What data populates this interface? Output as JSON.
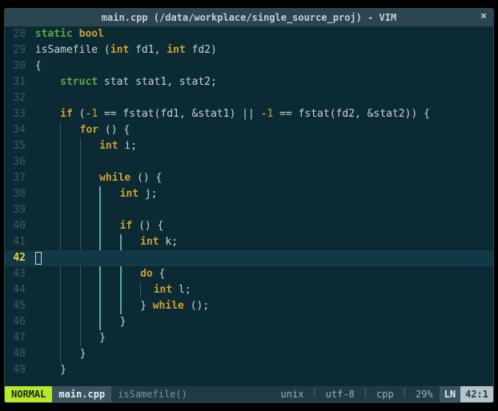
{
  "titlebar": {
    "title": "main.cpp (/data/workplace/single_source_proj) - VIM",
    "close": "×"
  },
  "gutter": {
    "lines": [
      "28",
      "29",
      "30",
      "31",
      "32",
      "33",
      "34",
      "35",
      "36",
      "37",
      "38",
      "39",
      "40",
      "41",
      "42",
      "43",
      "44",
      "45",
      "46",
      "47",
      "48",
      "49"
    ]
  },
  "code": {
    "l28_kw1": "static",
    "l28_sp": " ",
    "l28_kw2": "bool",
    "l29_fn": "isSamefile (",
    "l29_t1": "int",
    "l29_sp1": " fd1, ",
    "l29_t2": "int",
    "l29_sp2": " fd2)",
    "l30": "{",
    "l31_pad": "    ",
    "l31_kw": "struct",
    "l31_rest": " stat stat1, stat2;",
    "l32": "",
    "l33_pad": "    ",
    "l33_if": "if",
    "l33_a": " (-",
    "l33_n1": "1",
    "l33_b": " == fstat(fd1, &stat1) || -",
    "l33_n2": "1",
    "l33_c": " == fstat(fd2, &stat2)) {",
    "l34_pad": "        ",
    "l34_kw": "for",
    "l34_rest": " () {",
    "l35_pad": "            ",
    "l35_t": "int",
    "l35_rest": " i;",
    "l36": "",
    "l37_pad": "            ",
    "l37_kw": "while",
    "l37_rest": " () {",
    "l38_pad": "                ",
    "l38_t": "int",
    "l38_rest": " j;",
    "l39": "",
    "l40_pad": "                ",
    "l40_kw": "if",
    "l40_rest": " () {",
    "l41_pad": "                    ",
    "l41_t": "int",
    "l41_rest": " k;",
    "l42": "",
    "l43_pad": "                    ",
    "l43_kw": "do",
    "l43_rest": " {",
    "l44_pad": "                        ",
    "l44_t": "int",
    "l44_rest": " l;",
    "l45_pad": "                    } ",
    "l45_kw": "while",
    "l45_rest": " ();",
    "l46_pad": "                }",
    "l47_pad": "            }",
    "l48_pad": "        }",
    "l49_pad": "    }"
  },
  "status": {
    "mode": "NORMAL",
    "file": "main.cpp",
    "func": "isSamefile()",
    "fileformat": "unix",
    "encoding": "utf-8",
    "filetype": "cpp",
    "percent": "29%",
    "ln_label": "LN",
    "line": "42",
    "col": "1"
  }
}
